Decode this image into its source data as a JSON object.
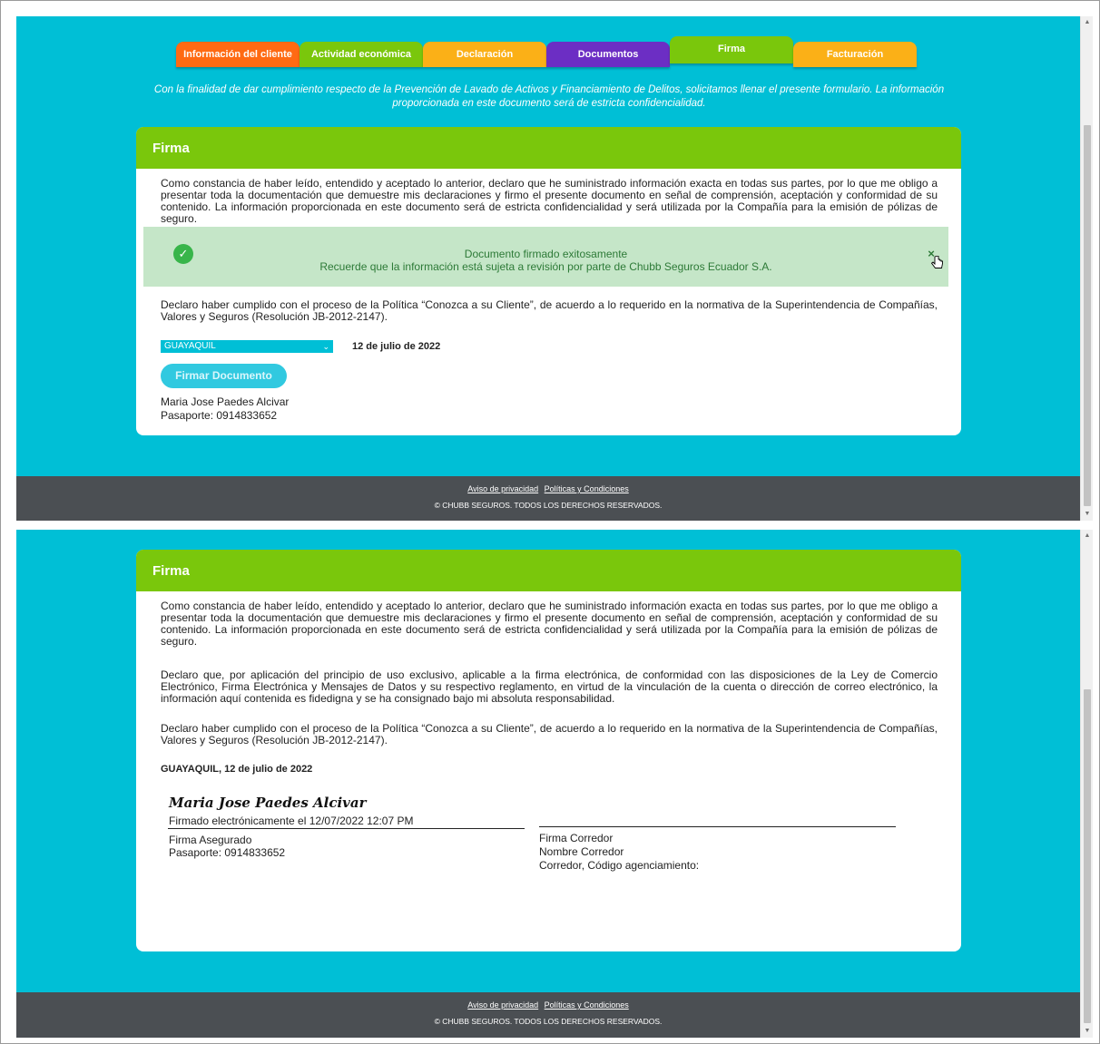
{
  "tabs": [
    {
      "label": "Información del cliente"
    },
    {
      "label": "Actividad económica"
    },
    {
      "label": "Declaración"
    },
    {
      "label": "Documentos"
    },
    {
      "label": "Firma"
    },
    {
      "label": "Facturación"
    }
  ],
  "intro_text": "Con la finalidad de dar cumplimiento respecto de la Prevención de Lavado de Activos y Financiamiento de Delitos, solicitamos llenar el presente formulario. La información proporcionada en este documento será de estricta confidencialidad.",
  "card_title": "Firma",
  "declaration_1": "Como constancia de haber leído, entendido y aceptado lo anterior, declaro que he suministrado información exacta en todas sus partes, por lo que me obligo a presentar toda la documentación que demuestre mis declaraciones y firmo el presente documento en señal de comprensión, aceptación y conformidad de su contenido. La información proporcionada en este documento será de estricta confidencialidad y será utilizada por la Compañía para la emisión de pólizas de seguro.",
  "declaration_2": "Declaro que, por aplicación del principio de uso exclusivo, aplicable a la firma electrónica, de conformidad con las disposiciones de la Ley de Comercio Electrónico, Firma Electrónica y Mensajes de Datos y su respectivo reglamento, en virtud de la vinculación de la cuenta o dirección de correo electrónico, la información aquí contenida es fidedigna y se ha consignado bajo mi absoluta responsabilidad.",
  "declaration_3": "Declaro haber cumplido con el proceso de la Política “Conozca a su Cliente”, de acuerdo a lo requerido en la normativa de la Superintendencia de Compañías, Valores y Seguros (Resolución JB-2012-2147).",
  "alert": {
    "title": "Documento firmado exitosamente",
    "message": "Recuerde que la información está sujeta a revisión por parte de Chubb Seguros Ecuador S.A.",
    "close": "×",
    "check": "✓"
  },
  "city_select": {
    "value": "GUAYAQUIL",
    "chevron": "⌄"
  },
  "date": "12 de julio de 2022",
  "sign_button": "Firmar Documento",
  "signer": {
    "name": "Maria Jose Paedes Alcivar",
    "passport": "Pasaporte: 0914833652"
  },
  "place_date": "GUAYAQUIL, 12 de julio de 2022",
  "signature": {
    "script_name": "Maria Jose Paedes Alcivar",
    "electronic_note": "Firmado electrónicamente el 12/07/2022 12:07 PM",
    "insured_label": "Firma Asegurado",
    "insured_passport": "Pasaporte: 0914833652",
    "broker_signature": "Firma Corredor",
    "broker_name": "Nombre Corredor",
    "broker_code": "Corredor, Código agenciamiento:"
  },
  "footer": {
    "privacy": "Aviso de privacidad",
    "policies": "Políticas y Condiciones",
    "copyright": "© CHUBB SEGUROS. TODOS LOS DERECHOS RESERVADOS."
  },
  "colors": {
    "background": "#00bfd6",
    "header_green": "#7ac70c",
    "footer": "#4b4f53",
    "alert_bg": "#c5e6c8"
  }
}
